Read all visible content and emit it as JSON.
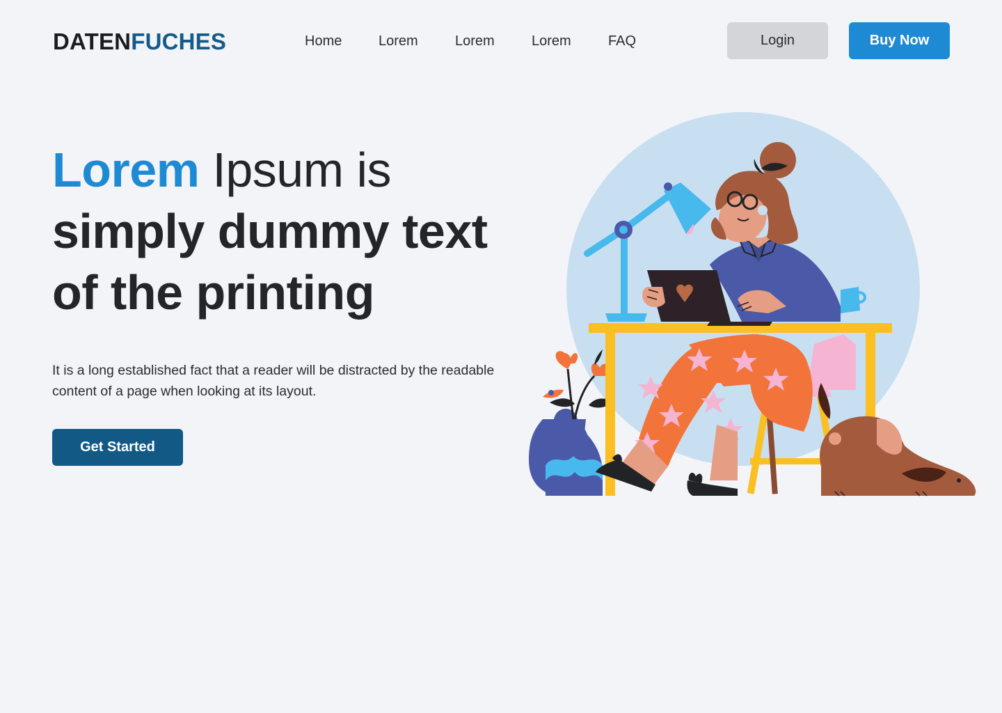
{
  "brand": {
    "part1": "DATEN",
    "part2": "FUCHES",
    "colors": {
      "dark": "#1b1c1f",
      "accent": "#155b89"
    }
  },
  "nav": {
    "items": [
      {
        "label": "Home"
      },
      {
        "label": "Lorem"
      },
      {
        "label": "Lorem"
      },
      {
        "label": "Lorem"
      },
      {
        "label": "FAQ"
      }
    ]
  },
  "header": {
    "login_label": "Login",
    "buy_label": "Buy Now"
  },
  "hero": {
    "title_accent": "Lorem",
    "title_line1_rest": " Ipsum is",
    "title_line2": "simply dummy text",
    "title_line3": "of the printing",
    "description": "It is a long established fact that a reader will be distracted by the readable content of a page when looking at its layout.",
    "cta_label": "Get Started"
  },
  "colors": {
    "background": "#f2f4f8",
    "accent_blue": "#1e8ad4",
    "cta_dark_blue": "#135985",
    "login_grey": "#d3d5d8"
  },
  "illustration": {
    "icon": "woman-at-desk-with-laptop-illustration"
  }
}
